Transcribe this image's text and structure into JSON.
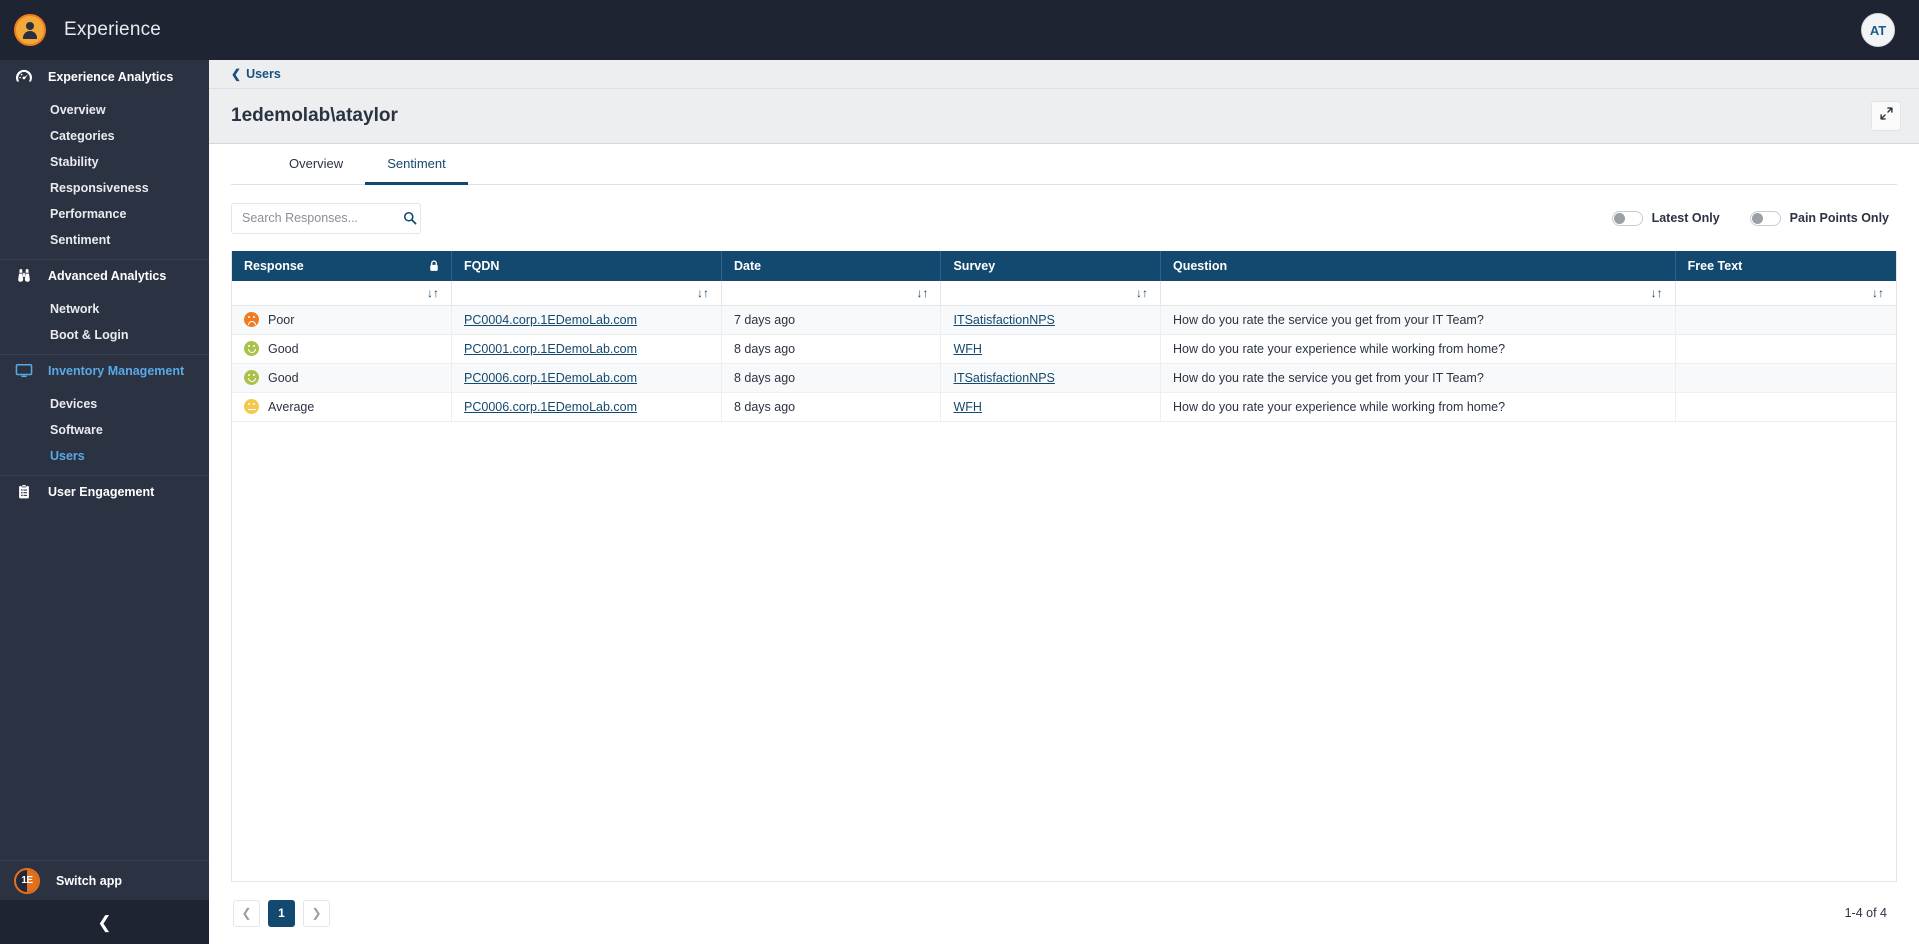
{
  "app": {
    "title": "Experience",
    "logo_icon": "user-circle-logo",
    "avatar_initials": "AT"
  },
  "sidebar": {
    "sections": [
      {
        "label": "Experience Analytics",
        "icon": "gauge-icon",
        "active": false,
        "items": [
          {
            "label": "Overview",
            "active": false
          },
          {
            "label": "Categories",
            "active": false
          },
          {
            "label": "Stability",
            "active": false
          },
          {
            "label": "Responsiveness",
            "active": false
          },
          {
            "label": "Performance",
            "active": false
          },
          {
            "label": "Sentiment",
            "active": false
          }
        ]
      },
      {
        "label": "Advanced Analytics",
        "icon": "binoculars-icon",
        "active": false,
        "items": [
          {
            "label": "Network",
            "active": false
          },
          {
            "label": "Boot & Login",
            "active": false
          }
        ]
      },
      {
        "label": "Inventory Management",
        "icon": "monitor-icon",
        "active": true,
        "items": [
          {
            "label": "Devices",
            "active": false
          },
          {
            "label": "Software",
            "active": false
          },
          {
            "label": "Users",
            "active": true
          }
        ]
      },
      {
        "label": "User Engagement",
        "icon": "clipboard-icon",
        "active": false,
        "items": []
      }
    ],
    "switch_app": {
      "label": "Switch app",
      "badge": "1E"
    },
    "collapse_icon": "chevron-left-icon"
  },
  "breadcrumb": {
    "back_icon": "chevron-left-icon",
    "label": "Users"
  },
  "header": {
    "title": "1edemolab\\ataylor",
    "expand_icon": "expand-arrows-icon"
  },
  "tabs": [
    {
      "label": "Overview",
      "active": false
    },
    {
      "label": "Sentiment",
      "active": true
    }
  ],
  "search": {
    "placeholder": "Search Responses...",
    "value": "",
    "icon": "search-icon"
  },
  "toggles": [
    {
      "label": "Latest Only",
      "on": false
    },
    {
      "label": "Pain Points Only",
      "on": false
    }
  ],
  "table": {
    "columns": [
      {
        "label": "Response",
        "lock": true,
        "sortable": true
      },
      {
        "label": "FQDN",
        "lock": false,
        "sortable": true
      },
      {
        "label": "Date",
        "lock": false,
        "sortable": true
      },
      {
        "label": "Survey",
        "lock": false,
        "sortable": true
      },
      {
        "label": "Question",
        "lock": false,
        "sortable": true
      },
      {
        "label": "Free Text",
        "lock": false,
        "sortable": true
      }
    ],
    "sort_icon": "sort-updown-icon",
    "rows": [
      {
        "response": "Poor",
        "response_mood": "poor",
        "fqdn": "PC0004.corp.1EDemoLab.com",
        "date": "7 days ago",
        "survey": "ITSatisfactionNPS",
        "question": "How do you rate the service you get from your IT Team?",
        "free_text": ""
      },
      {
        "response": "Good",
        "response_mood": "good",
        "fqdn": "PC0001.corp.1EDemoLab.com",
        "date": "8 days ago",
        "survey": "WFH",
        "question": "How do you rate your experience while working from home?",
        "free_text": ""
      },
      {
        "response": "Good",
        "response_mood": "good",
        "fqdn": "PC0006.corp.1EDemoLab.com",
        "date": "8 days ago",
        "survey": "ITSatisfactionNPS",
        "question": "How do you rate the service you get from your IT Team?",
        "free_text": ""
      },
      {
        "response": "Average",
        "response_mood": "average",
        "fqdn": "PC0006.corp.1EDemoLab.com",
        "date": "8 days ago",
        "survey": "WFH",
        "question": "How do you rate your experience while working from home?",
        "free_text": ""
      }
    ]
  },
  "pagination": {
    "prev_icon": "chevron-left-icon",
    "next_icon": "chevron-right-icon",
    "pages": [
      "1"
    ],
    "current_page": "1",
    "range_text": "1-4 of 4"
  },
  "colors": {
    "brand_orange": "#f0931e",
    "sidebar_bg": "#2b3242",
    "topbar_bg": "#1f2433",
    "table_header_blue": "#14496f",
    "link_blue": "#14496f",
    "active_nav_blue": "#5aa9e6",
    "mood_good": "#a8c24a",
    "mood_average": "#f2c94c",
    "mood_poor": "#ef7c22"
  }
}
